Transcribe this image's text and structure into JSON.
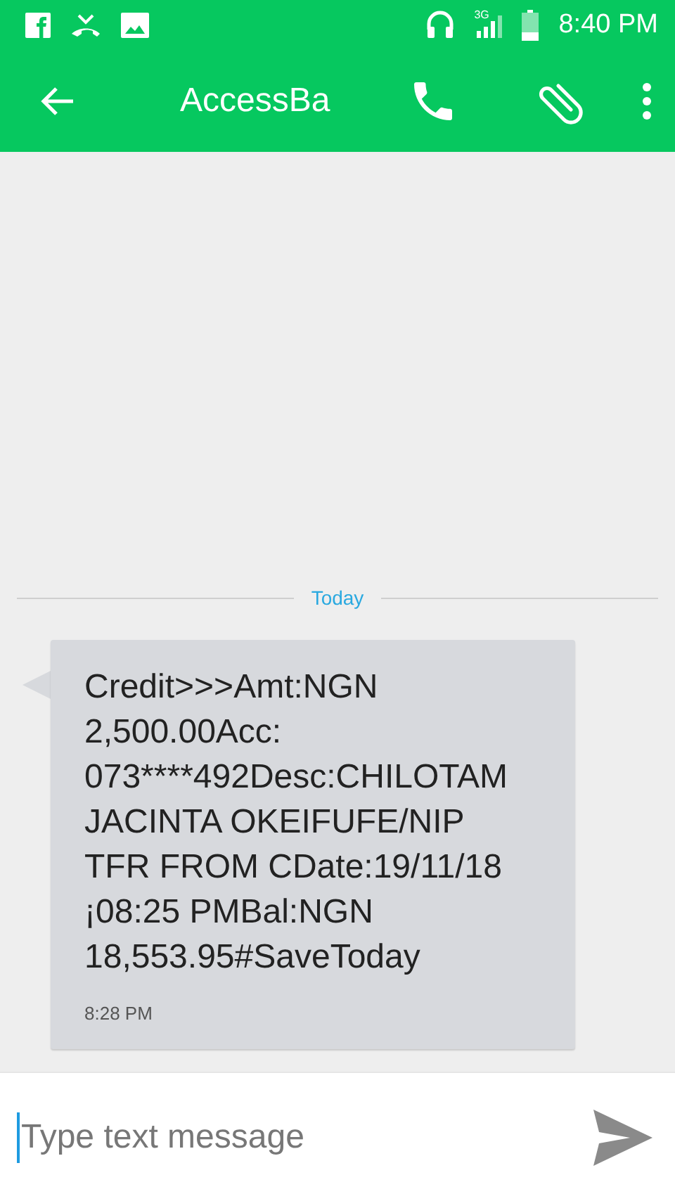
{
  "status_bar": {
    "network_type": "3G",
    "time": "8:40 PM"
  },
  "toolbar": {
    "title": "AccessBa"
  },
  "thread": {
    "date_divider": "Today",
    "messages": [
      {
        "body": "Credit>>>Amt:NGN\n2,500.00Acc:\n073****492Desc:CHILOTAM\nJACINTA OKEIFUFE/NIP\nTFR FROM CDate:19/11/18\n¡08:25 PMBal:NGN\n18,553.95#SaveToday",
        "time": "8:28 PM"
      }
    ]
  },
  "composer": {
    "placeholder": "Type text message"
  }
}
